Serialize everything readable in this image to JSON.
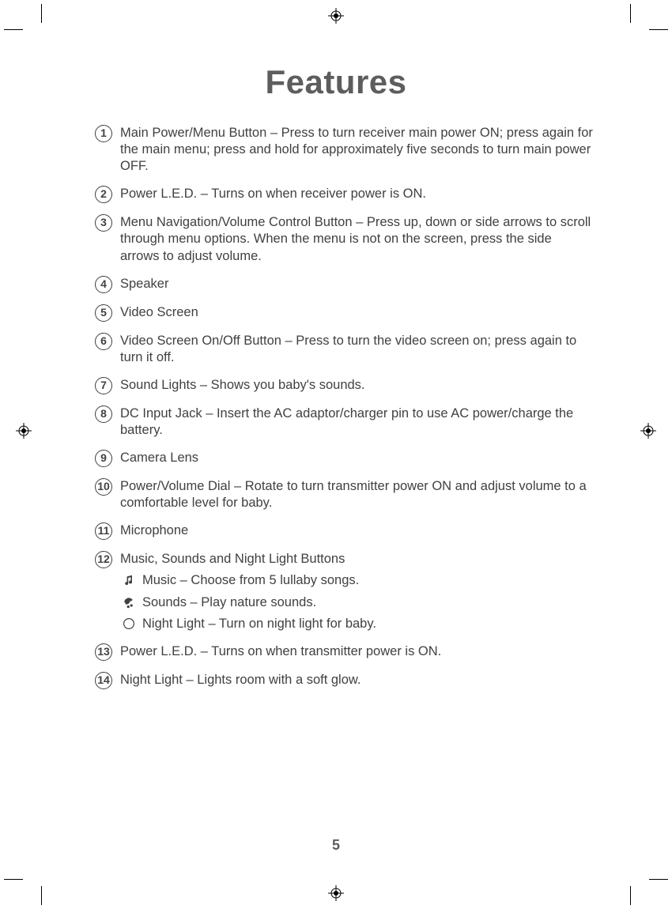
{
  "title": "Features",
  "page_number": "5",
  "items": [
    {
      "n": "1",
      "text": "Main Power/Menu Button – Press to turn receiver main power ON; press again for the main menu; press and hold for approximately five seconds to turn main power OFF."
    },
    {
      "n": "2",
      "text": "Power L.E.D. – Turns on when receiver power is ON."
    },
    {
      "n": "3",
      "text": "Menu Navigation/Volume Control Button – Press up, down or side arrows to scroll through menu options. When the menu is not on the screen, press the side arrows to adjust volume."
    },
    {
      "n": "4",
      "text": "Speaker"
    },
    {
      "n": "5",
      "text": "Video Screen"
    },
    {
      "n": "6",
      "text": "Video Screen On/Off Button – Press to turn the video screen on; press again to turn it off."
    },
    {
      "n": "7",
      "text": "Sound Lights – Shows you baby's sounds."
    },
    {
      "n": "8",
      "text": "DC Input Jack – Insert the AC adaptor/charger pin to use AC power/charge the battery."
    },
    {
      "n": "9",
      "text": "Camera Lens"
    },
    {
      "n": "10",
      "text": "Power/Volume Dial – Rotate to turn transmitter power ON and adjust volume to a comfortable level for baby."
    },
    {
      "n": "11",
      "text": "Microphone"
    },
    {
      "n": "12",
      "text": "Music, Sounds and Night Light Buttons",
      "subs": [
        {
          "icon": "music-icon",
          "text": "Music – Choose from 5 lullaby songs."
        },
        {
          "icon": "sounds-icon",
          "text": "Sounds – Play nature sounds."
        },
        {
          "icon": "night-light-icon",
          "text": "Night Light – Turn on night light for baby."
        }
      ]
    },
    {
      "n": "13",
      "text": "Power L.E.D. – Turns on when transmitter power is ON."
    },
    {
      "n": "14",
      "text": "Night Light – Lights room with a soft glow."
    }
  ]
}
